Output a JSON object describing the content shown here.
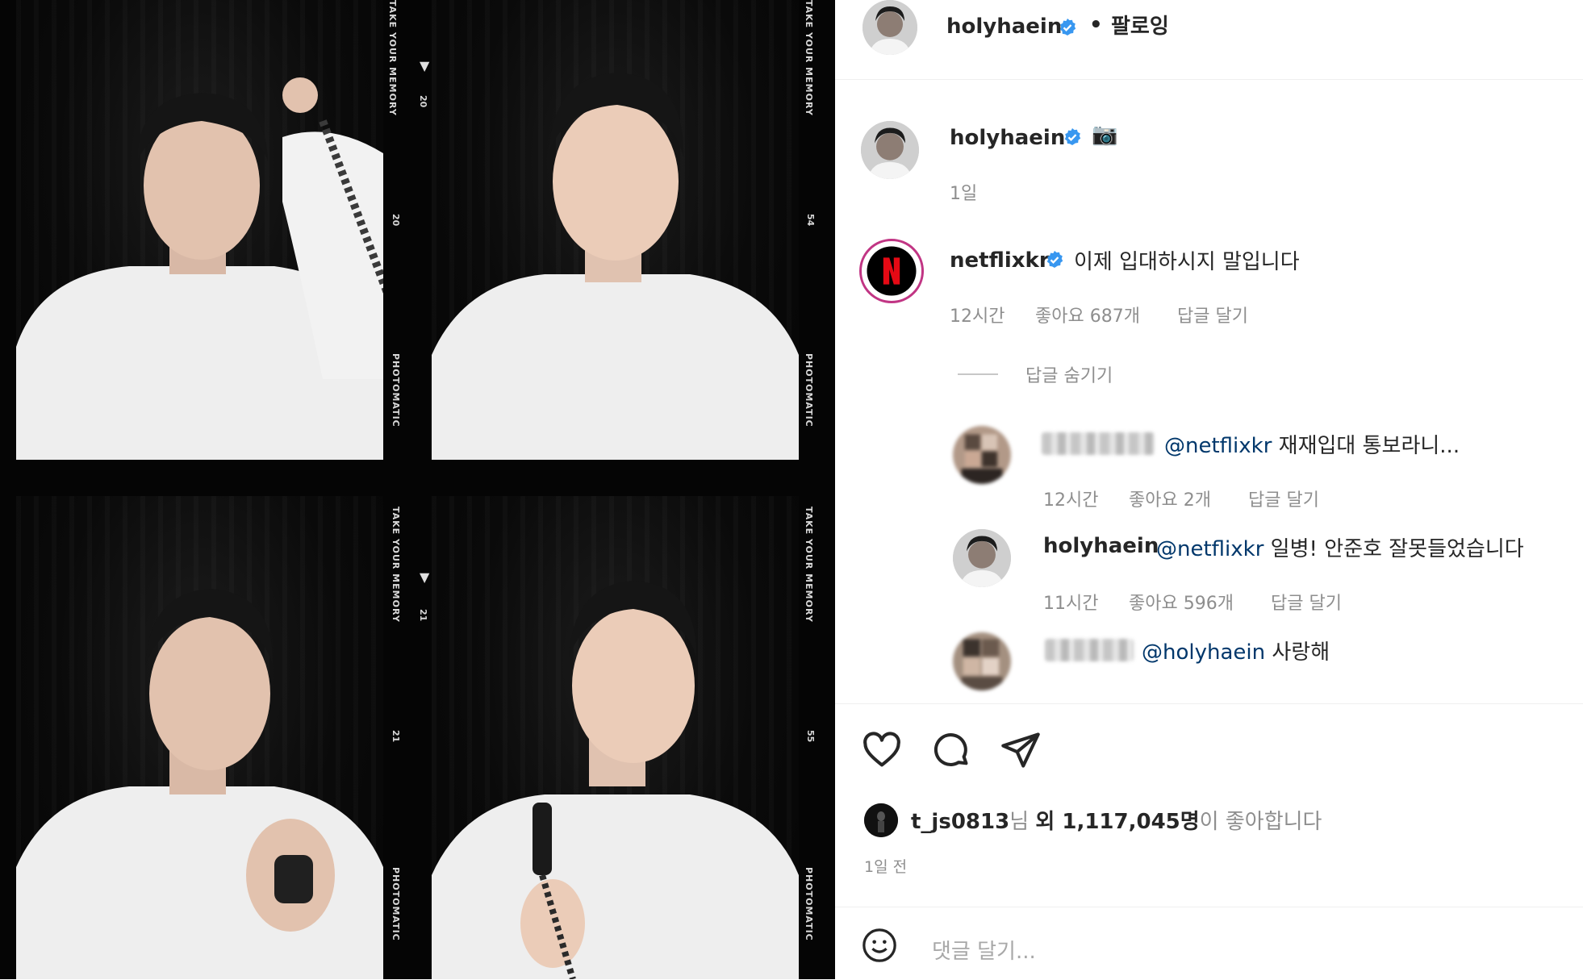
{
  "header": {
    "username": "holyhaein",
    "separator": "•",
    "follow_status": "팔로잉"
  },
  "caption": {
    "username": "holyhaein",
    "emoji": "📷",
    "time": "1일"
  },
  "comments": [
    {
      "username": "netflixkr",
      "text": "이제 입대하시지 말입니다",
      "time": "12시간",
      "likes": "좋아요 687개",
      "reply_label": "답글 달기"
    }
  ],
  "hide_replies_label": "답글 숨기기",
  "replies": [
    {
      "username": "",
      "mention": "@netflixkr",
      "text": "재재입대 통보라니...",
      "time": "12시간",
      "likes": "좋아요 2개",
      "reply_label": "답글 달기"
    },
    {
      "username": "holyhaein",
      "mention": "@netflixkr",
      "text": "일병! 안준호 잘못들었습니다",
      "time": "11시간",
      "likes": "좋아요 596개",
      "reply_label": "답글 달기"
    },
    {
      "username": "",
      "mention": "@holyhaein",
      "text": "사랑해"
    }
  ],
  "likes_summary": {
    "user": "t_js0813",
    "suffix1": "님 ",
    "oe": "외 ",
    "count": "1,117,045명",
    "suffix2": "이 좋아합니다"
  },
  "post_time": "1일 전",
  "comment_input": {
    "placeholder": "댓글 달기..."
  },
  "photo_strip": {
    "left_labels": [
      "TAKE YOUR MEMORY",
      "PHOTOMATIC",
      "TAKE YOUR MEMORY",
      "PHOTOMATIC"
    ],
    "left_numbers": [
      "20",
      "20",
      "21",
      "21"
    ],
    "right_labels": [
      "TAKE YOUR MEMORY",
      "PHOTOMATIC",
      "TAKE YOUR MEMORY",
      "PHOTOMATIC"
    ],
    "right_numbers": [
      "54",
      "55"
    ]
  },
  "colors": {
    "verified": "#3897f0",
    "netflix_red": "#e50914",
    "mention": "#00376b",
    "meta_gray": "#8e8e8e"
  }
}
